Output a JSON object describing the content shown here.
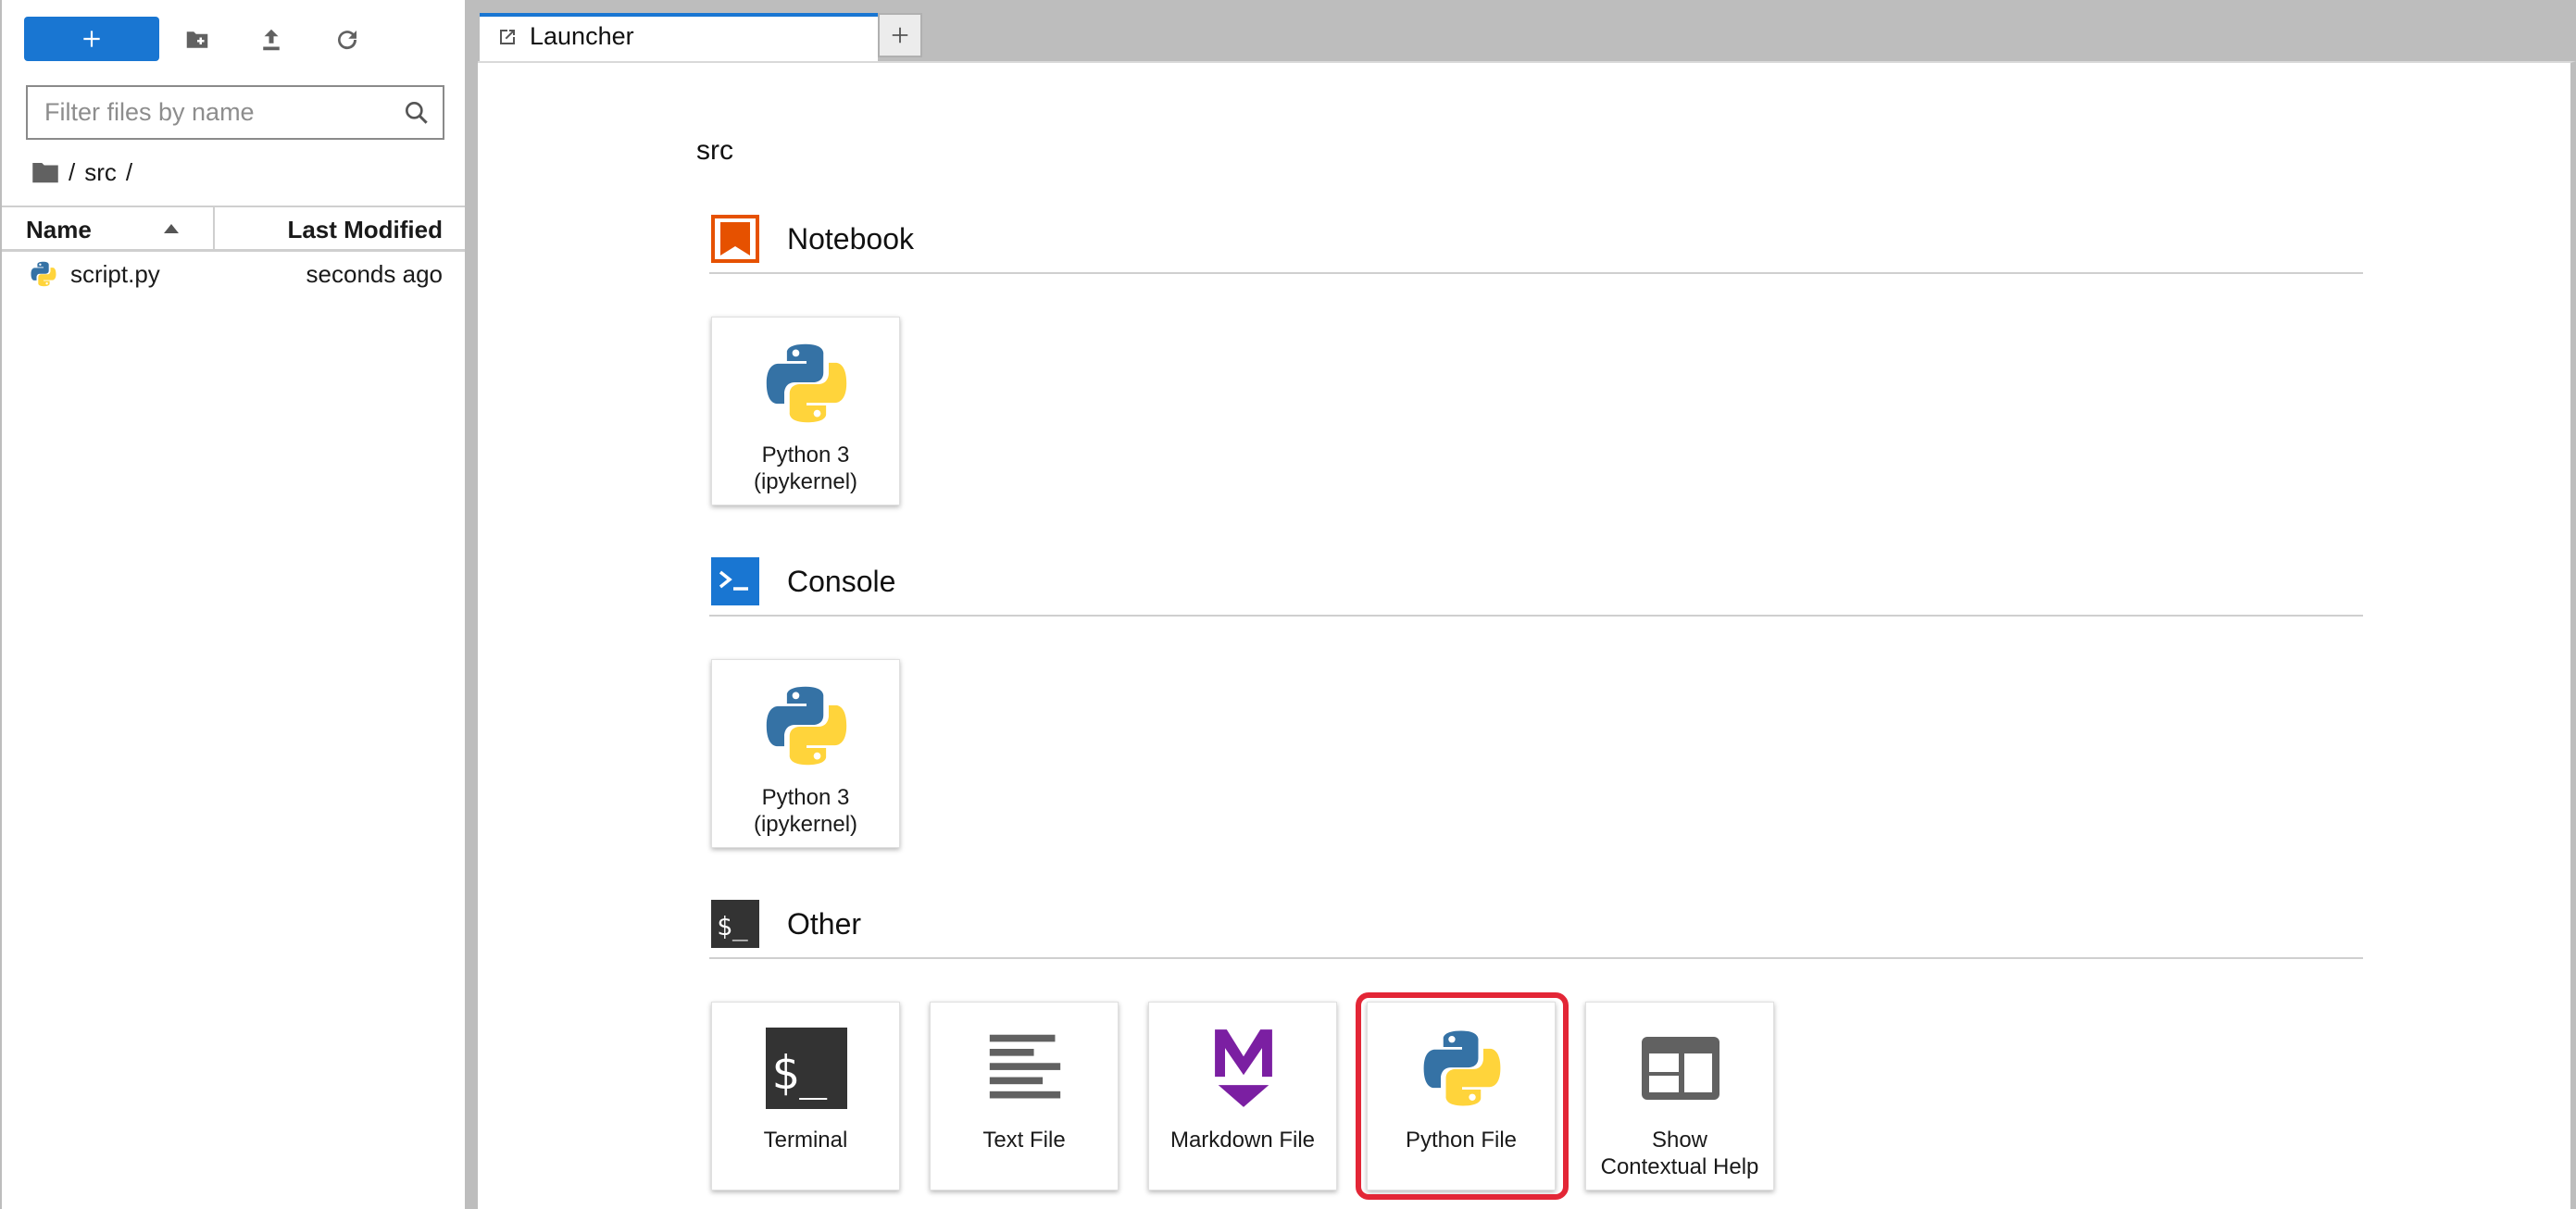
{
  "file_browser": {
    "filter_placeholder": "Filter files by name",
    "breadcrumb": [
      "/",
      "src",
      "/"
    ],
    "columns": {
      "name": "Name",
      "modified": "Last Modified"
    },
    "files": [
      {
        "name": "script.py",
        "modified": "seconds ago"
      }
    ]
  },
  "tabs": [
    {
      "label": "Launcher"
    }
  ],
  "launcher": {
    "cwd": "src",
    "sections": [
      {
        "title": "Notebook",
        "cards": [
          {
            "label_line1": "Python 3",
            "label_line2": "(ipykernel)"
          }
        ]
      },
      {
        "title": "Console",
        "cards": [
          {
            "label_line1": "Python 3",
            "label_line2": "(ipykernel)"
          }
        ]
      },
      {
        "title": "Other",
        "cards": [
          {
            "label_line1": "Terminal",
            "label_line2": ""
          },
          {
            "label_line1": "Text File",
            "label_line2": ""
          },
          {
            "label_line1": "Markdown File",
            "label_line2": ""
          },
          {
            "label_line1": "Python File",
            "label_line2": ""
          },
          {
            "label_line1": "Show",
            "label_line2": "Contextual Help"
          }
        ]
      }
    ]
  },
  "colors": {
    "accent": "#1976d2",
    "notebook_icon": "#e65100",
    "console_icon": "#1976d2",
    "markdown_icon": "#7b1fa2",
    "highlight": "#e32636"
  }
}
